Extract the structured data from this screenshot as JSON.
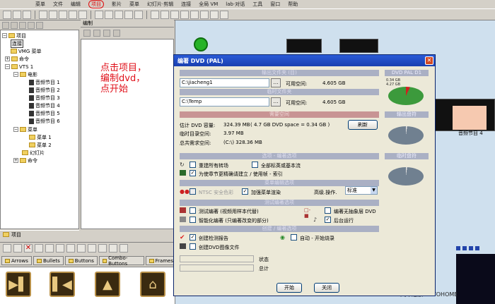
{
  "app": {
    "menu": [
      "菜单",
      "文件",
      "编辑",
      "项目",
      "影片",
      "菜单",
      "幻灯片·剪辑",
      "连接",
      "全局 VM",
      "lab·对话",
      "工具",
      "窗口",
      "帮助"
    ],
    "highlighted_menu": "项目"
  },
  "tree": {
    "root": "项目",
    "connect": "连接",
    "vmg": "VMG 菜单",
    "cmd": "命令",
    "vts": "VTS 1",
    "movie": "电影",
    "audio_items": [
      "音频节目 1",
      "音频节目 2",
      "音频节目 3",
      "音频节目 4",
      "音频节目 5",
      "音频节目 6"
    ],
    "menu": "菜单",
    "menu_items": [
      "菜单 1",
      "菜单 2"
    ],
    "slideshow": "幻灯片",
    "cmd2": "命令"
  },
  "edit_panel": {
    "header": "编制",
    "annotation": "点击项目，编制dvd，点开始"
  },
  "project_tab": "项目",
  "button_tabs": [
    "Arrows",
    "Bullets",
    "Buttons",
    "Combo-Buttons",
    "Frames"
  ],
  "canvas": {
    "thumb_label": "音频节目 4"
  },
  "watermark": "汽车之家 AUTOHOME",
  "dialog": {
    "title": "编著 DVD (PAL)",
    "sec_output": "输出文件夹 (目)",
    "sec_temp": "临时文件夹",
    "sec_space": "需要空间",
    "sec_options": "选项 - 编著选项",
    "sec_menu": "菜单编辑选项",
    "sec_test": "测试编著选项",
    "sec_create": "创建 / 编著选项",
    "side_dvd": "DVD PAL D1",
    "side_output": "输出盘符",
    "side_temp": "临时盘符",
    "output_path": "C:\\jiacheng1",
    "temp_path": "C:\\Temp",
    "avail_label": "可用空间:",
    "avail_value": "4.605 GB",
    "avail_value2": "4.605 GB",
    "est_label": "估计 DVD 容量:",
    "est_value": "324.39 MB",
    "est_detail": "( 4.7 GB DVD space = 0.34 GB )",
    "temp_space_label": "临时目录空间:",
    "temp_space_value": "3.97 MB",
    "total_label": "总共需求空间:",
    "total_value": "(C:\\) 328.36 MB",
    "refresh": "刷新",
    "opt_rebuild": "重建所有转场",
    "opt_full": "全部标英或基本流",
    "opt_chapter": "为使章节更精确请建立 / 使用帧 - 索引",
    "opt_ntsc": "NTSC 安全色彩",
    "opt_enhance": "加强菜单渲染",
    "adv_label": "高级.操作.",
    "adv_value": "标准",
    "opt_test": "测试编著 (视频用样本代替)",
    "opt_nomenu": "编著无抽象层 DVD",
    "opt_smart": "智能化编著 (只编著改变的部分)",
    "opt_bg": "后台运行",
    "opt_report": "创建检测报告",
    "opt_auto": "自动 - 开始烧录",
    "opt_image": "创建DVD图像文件",
    "status_label": "状态",
    "total_status_label": "总计",
    "start_btn": "开始",
    "close_btn": "关闭",
    "legend_lines": [
      "0.34 GB",
      "4.27 GB"
    ]
  }
}
